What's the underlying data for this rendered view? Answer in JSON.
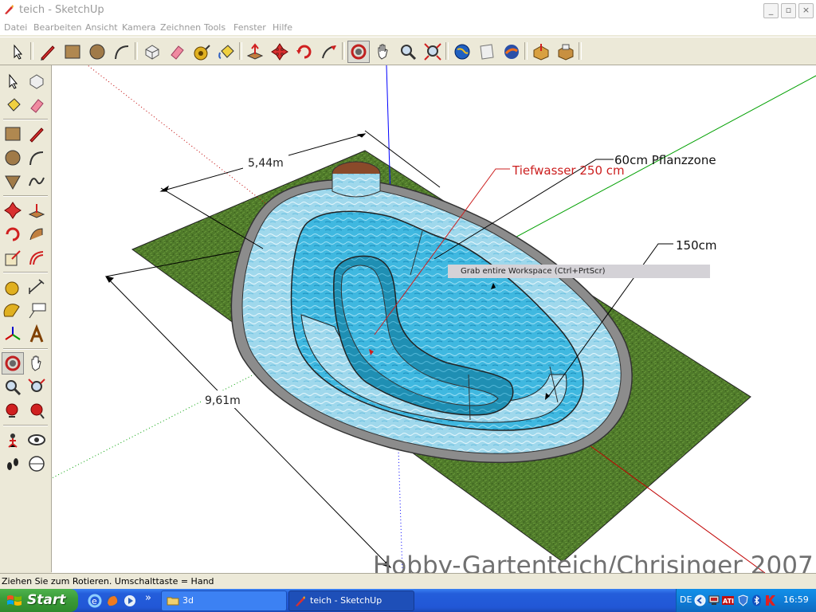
{
  "window": {
    "title": "teich - SketchUp"
  },
  "menu": [
    "Datei",
    "Bearbeiten",
    "Ansicht",
    "Kamera",
    "Zeichnen",
    "Tools",
    "Fenster",
    "Hilfe"
  ],
  "top_toolbar": [
    "select-icon",
    "pencil-icon",
    "rectangle-icon",
    "circle-icon",
    "arc-icon",
    "make-component-icon",
    "eraser-icon",
    "tape-measure-icon",
    "paint-bucket-icon",
    "push-pull-icon",
    "move-icon",
    "rotate-icon",
    "follow-me-icon",
    "orbit-icon",
    "pan-icon",
    "zoom-icon",
    "zoom-extents-icon",
    "google-earth-icon",
    "place-model-icon",
    "get-models-icon",
    "share-model-icon",
    "components-icon"
  ],
  "left_toolbar": [
    "select-icon",
    "make-component-icon",
    "paint-bucket-icon",
    "eraser-icon",
    "rectangle-icon",
    "line-icon",
    "circle-icon",
    "arc-icon",
    "polygon-icon",
    "freehand-icon",
    "move-icon",
    "push-pull-icon",
    "rotate-icon",
    "follow-me-icon",
    "scale-icon",
    "offset-icon",
    "tape-measure-icon",
    "dimension-icon",
    "protractor-icon",
    "text-icon",
    "axes-icon",
    "3d-text-icon",
    "orbit-icon",
    "pan-icon",
    "zoom-icon",
    "zoom-window-icon",
    "previous-view-icon",
    "zoom-extents-icon",
    "position-camera-icon",
    "look-around-icon",
    "walk-icon",
    "section-plane-icon"
  ],
  "model": {
    "dim_width": "5,44m",
    "dim_length": "9,61m",
    "label_pflanzzone": "60cm Pflanzzone",
    "label_tiefwasser": "Tiefwasser 250 cm",
    "label_150": "150cm"
  },
  "tooltip": "Grab entire Workspace (Ctrl+PrtScr)",
  "watermark": "Hobby-Gartenteich/Chrisinger 2007",
  "status": "Ziehen Sie zum Rotieren.  Umschalttaste = Hand",
  "taskbar": {
    "start": "Start",
    "tasks": [
      "3d",
      "teich - SketchUp"
    ],
    "language": "DE",
    "clock": "16:59"
  },
  "colors": {
    "grass": "#4f7a2a",
    "water": "#3fb8e0",
    "rim": "#8c8c8c",
    "axis_blue": "#0000ff",
    "axis_green": "#00a000",
    "axis_red": "#c00000",
    "taskbar": "#245edb",
    "start": "#3c9d3a"
  }
}
